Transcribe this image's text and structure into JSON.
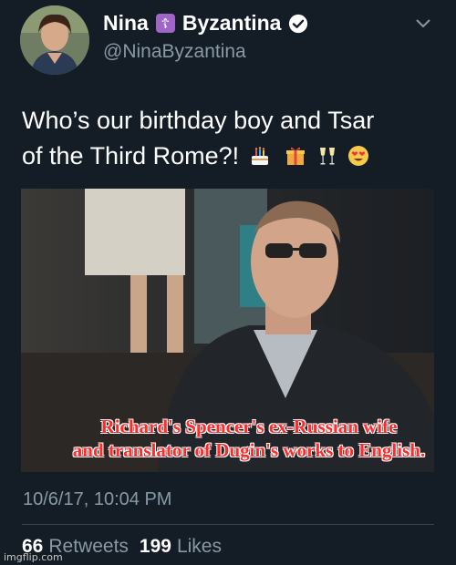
{
  "user": {
    "display_name_first": "Nina",
    "display_name_last": "Byzantina",
    "name_symbol": "☦",
    "handle": "@NinaByzantina"
  },
  "tweet": {
    "text_line1": "Who’s our birthday boy and Tsar",
    "text_line2": "of the Third Rome?!",
    "emojis": [
      "birthday-cake",
      "wrapped-gift",
      "clinking-glasses",
      "heart-eyes"
    ],
    "timestamp": "10/6/17, 10:04 PM"
  },
  "photo": {
    "caption_line1": "Richard's Spencer's ex-Russian wife",
    "caption_line2": "and translator of Dugin's works to English."
  },
  "stats": {
    "retweets_count": "66",
    "retweets_label": "Retweets",
    "likes_count": "199",
    "likes_label": "Likes"
  },
  "watermark": "imgflip.com",
  "colors": {
    "background": "#141d26",
    "secondary_text": "#8899a6",
    "caption": "#ff2a2a",
    "verified": "#ffffff"
  }
}
